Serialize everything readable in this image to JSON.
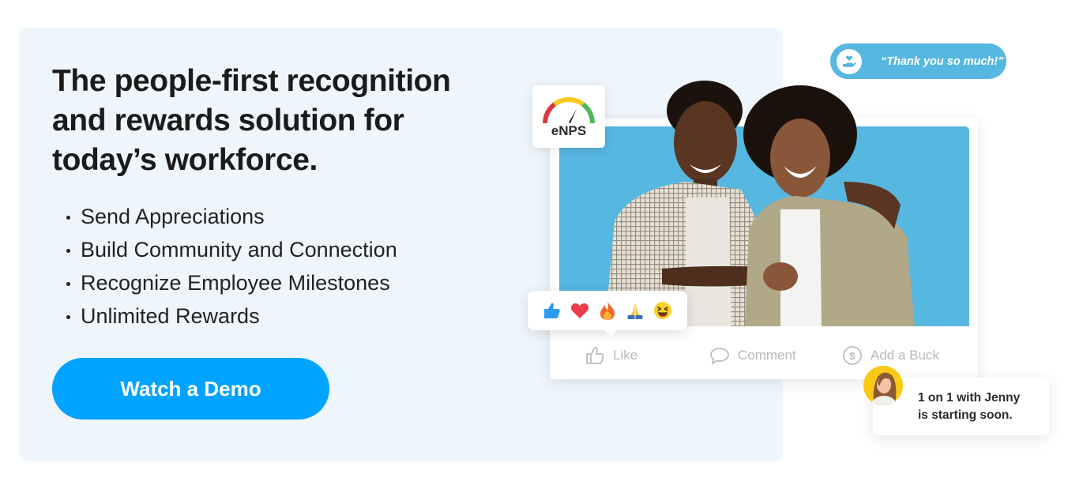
{
  "hero": {
    "headline": "The people-first recognition and rewards solution for today’s workforce.",
    "features": [
      "Send Appreciations",
      "Build Community and Connection",
      "Recognize Employee Milestones",
      "Unlimited Rewards"
    ],
    "cta_label": "Watch a Demo"
  },
  "colors": {
    "panel_bg": "#eef6fc",
    "cta_blue": "#00a3ff",
    "photo_blue": "#56b7e0",
    "gauge_red": "#d9363e",
    "gauge_yellow": "#f7c91c",
    "gauge_green": "#4cb85c"
  },
  "enps": {
    "label": "eNPS",
    "icon": "gauge-icon"
  },
  "thanks_bubble": {
    "text": "“Thank you so much!”",
    "icon": "hand-heart-icon"
  },
  "post": {
    "reactions": [
      {
        "name": "thumbs-up",
        "icon": "thumbs-up-emoji-icon"
      },
      {
        "name": "heart",
        "icon": "heart-emoji-icon"
      },
      {
        "name": "fire",
        "icon": "fire-emoji-icon"
      },
      {
        "name": "pray",
        "icon": "praying-hands-emoji-icon"
      },
      {
        "name": "laugh",
        "icon": "laughing-face-emoji-icon"
      }
    ],
    "actions": {
      "like": "Like",
      "comment": "Comment",
      "add_buck": "Add a Buck"
    }
  },
  "notification": {
    "line1": "1 on 1 with Jenny",
    "line2": "is starting soon."
  }
}
